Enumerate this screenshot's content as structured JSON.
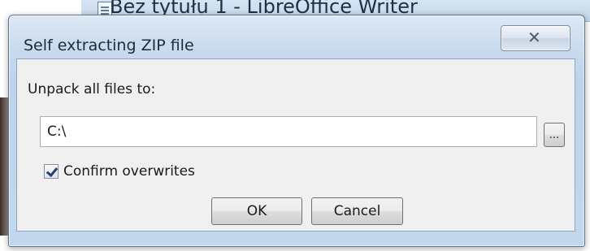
{
  "background_app": {
    "title": "Bez tytułu 1 - LibreOffice Writer"
  },
  "dialog": {
    "title": "Self extracting ZIP file",
    "close_symbol": "✕",
    "unpack_label": "Unpack all files to:",
    "path_value": "C:\\",
    "browse_label": "...",
    "confirm_label": "Confirm overwrites",
    "confirm_checked": true,
    "ok_label": "OK",
    "cancel_label": "Cancel"
  },
  "icons": {
    "doc": "document-icon",
    "close": "close-icon",
    "check": "checkmark-icon"
  }
}
